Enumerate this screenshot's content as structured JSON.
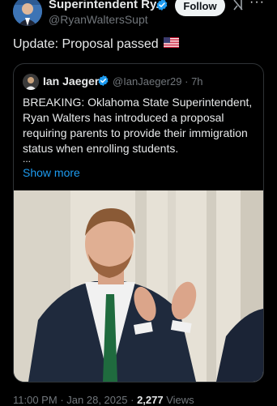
{
  "header": {
    "author_name": "Superintendent Ry...",
    "author_handle": "@RyanWaltersSupt",
    "follow_label": "Follow",
    "more_label": "···"
  },
  "tweet": {
    "text": "Update: Proposal passed",
    "flag_icon": "us-flag-icon"
  },
  "quote": {
    "author_name": "Ian Jaeger",
    "author_handle": "@IanJaeger29",
    "separator": "·",
    "time": "7h",
    "body": "BREAKING: Oklahoma State Superintendent, Ryan Walters has introduced a proposal requiring parents to provide their immigration status when enrolling students.",
    "ellipsis": "...",
    "show_more": "Show more"
  },
  "footer": {
    "time": "11:00 PM",
    "separator": "·",
    "date": "Jan 28, 2025",
    "views_count": "2,277",
    "views_label": "Views"
  },
  "colors": {
    "background": "#000000",
    "accent_blue": "#1d9bf0",
    "muted_text": "#71767b",
    "border": "#2f3336"
  }
}
